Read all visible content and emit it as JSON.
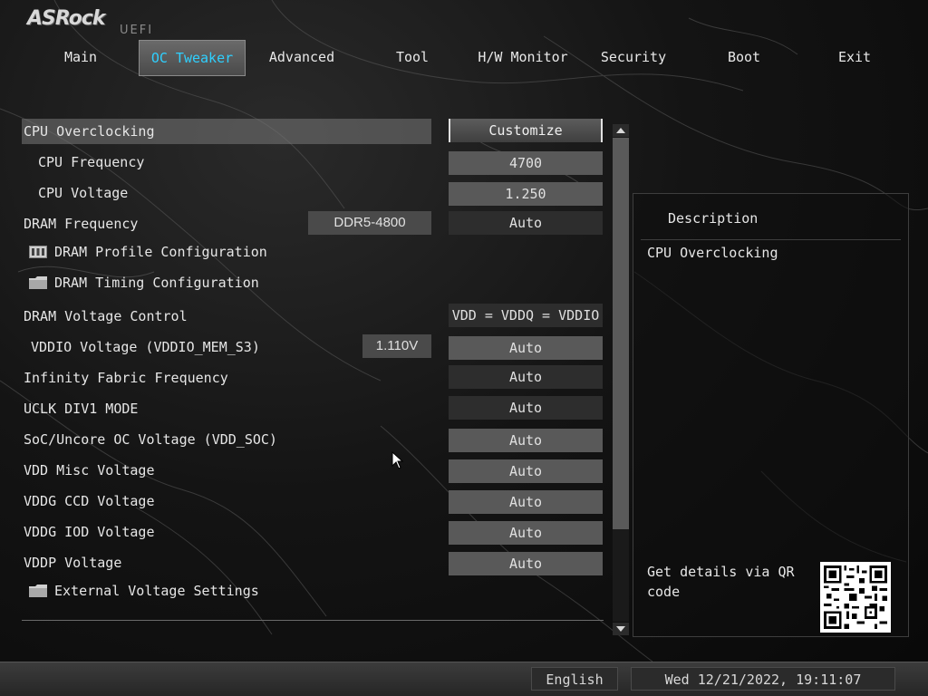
{
  "header": {
    "logo": "ASRock",
    "logo_sub": "UEFI"
  },
  "tabs": [
    {
      "label": "Main"
    },
    {
      "label": "OC Tweaker",
      "active": true
    },
    {
      "label": "Advanced"
    },
    {
      "label": "Tool"
    },
    {
      "label": "H/W Monitor"
    },
    {
      "label": "Security"
    },
    {
      "label": "Boot"
    },
    {
      "label": "Exit"
    }
  ],
  "settings": {
    "cpu_oc": {
      "label": "CPU Overclocking",
      "value": "Customize"
    },
    "cpu_freq": {
      "label": "CPU Frequency",
      "value": "4700"
    },
    "cpu_volt": {
      "label": "CPU Voltage",
      "value": "1.250"
    },
    "dram_freq": {
      "label": "DRAM Frequency",
      "current": "DDR5-4800",
      "value": "Auto"
    },
    "dram_profile": {
      "label": "DRAM Profile Configuration"
    },
    "dram_timing": {
      "label": "DRAM Timing Configuration"
    },
    "dram_volt_ctrl": {
      "label": "DRAM Voltage Control",
      "value": "VDD = VDDQ = VDDIO"
    },
    "vddio": {
      "label": "VDDIO Voltage (VDDIO_MEM_S3)",
      "current": "1.110V",
      "value": "Auto"
    },
    "if_freq": {
      "label": "Infinity Fabric Frequency",
      "value": "Auto"
    },
    "uclk": {
      "label": "UCLK DIV1 MODE",
      "value": "Auto"
    },
    "soc": {
      "label": "SoC/Uncore OC Voltage (VDD_SOC)",
      "value": "Auto"
    },
    "vdd_misc": {
      "label": "VDD Misc Voltage",
      "value": "Auto"
    },
    "vddg_ccd": {
      "label": "VDDG CCD Voltage",
      "value": "Auto"
    },
    "vddg_iod": {
      "label": "VDDG IOD Voltage",
      "value": "Auto"
    },
    "vddp": {
      "label": "VDDP Voltage",
      "value": "Auto"
    },
    "ext_volt": {
      "label": "External Voltage Settings"
    }
  },
  "description": {
    "title": "Description",
    "text": "CPU Overclocking",
    "qr_text": "Get details via QR code"
  },
  "status": {
    "language": "English",
    "datetime": "Wed 12/21/2022, 19:11:07"
  },
  "colors": {
    "active_tab_text": "#2fd0ff"
  }
}
